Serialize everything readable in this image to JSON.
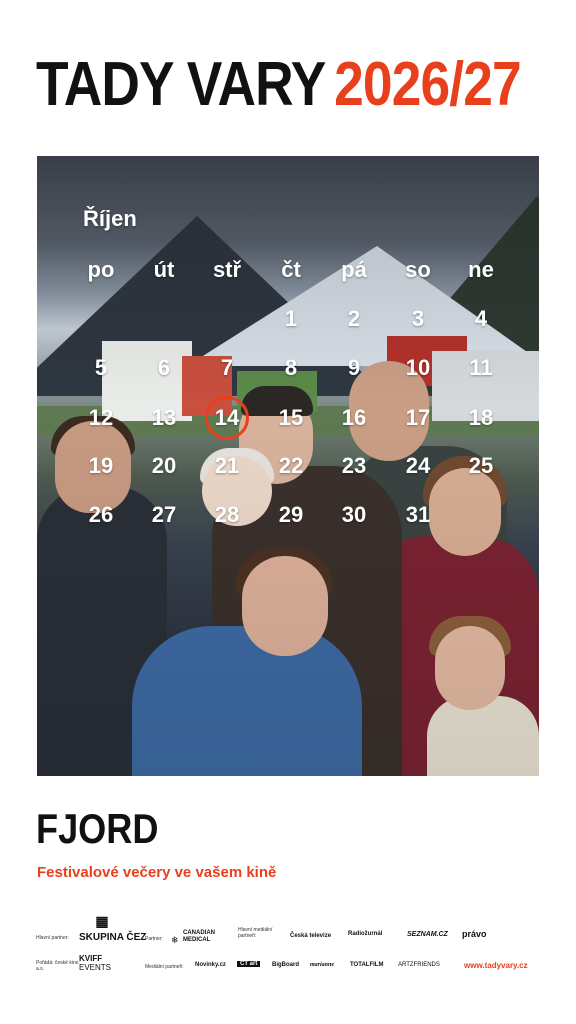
{
  "header": {
    "title_main": "TADY VARY",
    "title_year": "2026/27"
  },
  "colors": {
    "accent": "#e8401c",
    "text": "#111111",
    "background": "#ffffff"
  },
  "calendar": {
    "month": "Říjen",
    "weekdays": [
      "po",
      "út",
      "stř",
      "čt",
      "pá",
      "so",
      "ne"
    ],
    "first_weekday_index": 3,
    "days": [
      "1",
      "2",
      "3",
      "4",
      "5",
      "6",
      "7",
      "8",
      "9",
      "10",
      "11",
      "12",
      "13",
      "14",
      "15",
      "16",
      "17",
      "18",
      "19",
      "20",
      "21",
      "22",
      "23",
      "24",
      "25",
      "26",
      "27",
      "28",
      "29",
      "30",
      "31"
    ],
    "highlighted_day": "14"
  },
  "film": {
    "title": "FJORD",
    "tagline": "Festivalové večery ve vašem kině"
  },
  "partners": {
    "main_partner_label": "Hlavní partner:",
    "main_partner": "SKUPINA ČEZ",
    "partner_label": "Partner:",
    "partner_line1": "CANADIAN",
    "partner_line2": "MEDICAL",
    "main_media_label": "Hlavní mediální partneři:",
    "media_main": [
      "Česká televize",
      "Radiožurnál",
      "SEZNAM.CZ",
      "právo"
    ],
    "organizer_label": "Pořádá: české kino a.s.",
    "organizer_line1": "KVIFF",
    "organizer_line2": "EVENTS",
    "media_label": "Mediální partneři:",
    "media": [
      "Novinky.cz",
      "ČT art",
      "BigBoard",
      "marianne",
      "TOTALFILM",
      "ARTZFRIENDS"
    ],
    "website": "www.tadyvary.cz"
  }
}
